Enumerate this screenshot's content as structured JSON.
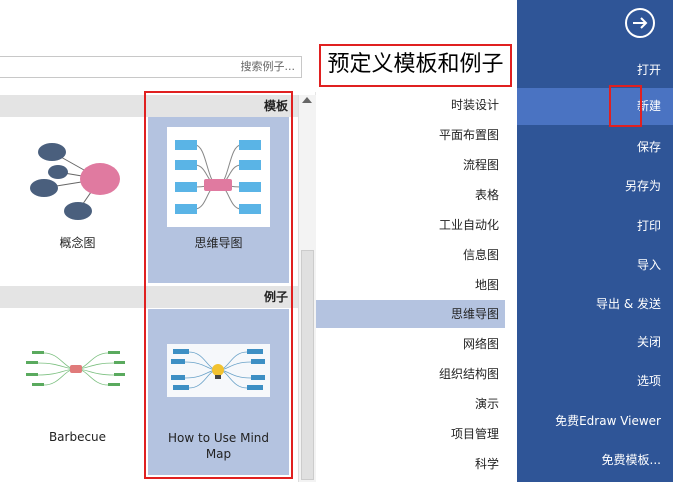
{
  "menu": {
    "items": [
      {
        "label": "打开"
      },
      {
        "label": "新建"
      },
      {
        "label": "保存"
      },
      {
        "label": "另存为"
      },
      {
        "label": "打印"
      },
      {
        "label": "导入"
      },
      {
        "label": "导出 & 发送"
      },
      {
        "label": "关闭"
      },
      {
        "label": "选项"
      },
      {
        "label": "免费Edraw Viewer"
      },
      {
        "label": "免费模板..."
      }
    ],
    "selected_index": 1,
    "colors": {
      "background": "#2f5597",
      "selected": "#4a73c2"
    }
  },
  "title": "预定义模板和例子",
  "search": {
    "placeholder": "搜索例子..."
  },
  "categories": [
    {
      "label": "时装设计"
    },
    {
      "label": "平面布置图"
    },
    {
      "label": "流程图"
    },
    {
      "label": "表格"
    },
    {
      "label": "工业自动化"
    },
    {
      "label": "信息图"
    },
    {
      "label": "地图"
    },
    {
      "label": "思维导图"
    },
    {
      "label": "网络图"
    },
    {
      "label": "组织结构图"
    },
    {
      "label": "演示"
    },
    {
      "label": "项目管理"
    },
    {
      "label": "科学"
    }
  ],
  "selected_category": "思维导图",
  "sections": {
    "templates": {
      "header": "模板",
      "items": [
        {
          "caption": "思维导图"
        },
        {
          "caption": "概念图"
        }
      ]
    },
    "examples": {
      "header": "例子",
      "items": [
        {
          "caption": "How to Use Mind Map"
        },
        {
          "caption": "Barbecue"
        }
      ]
    }
  },
  "colors": {
    "highlight_box": "#e02020",
    "selected_bg": "#b4c3e0"
  }
}
